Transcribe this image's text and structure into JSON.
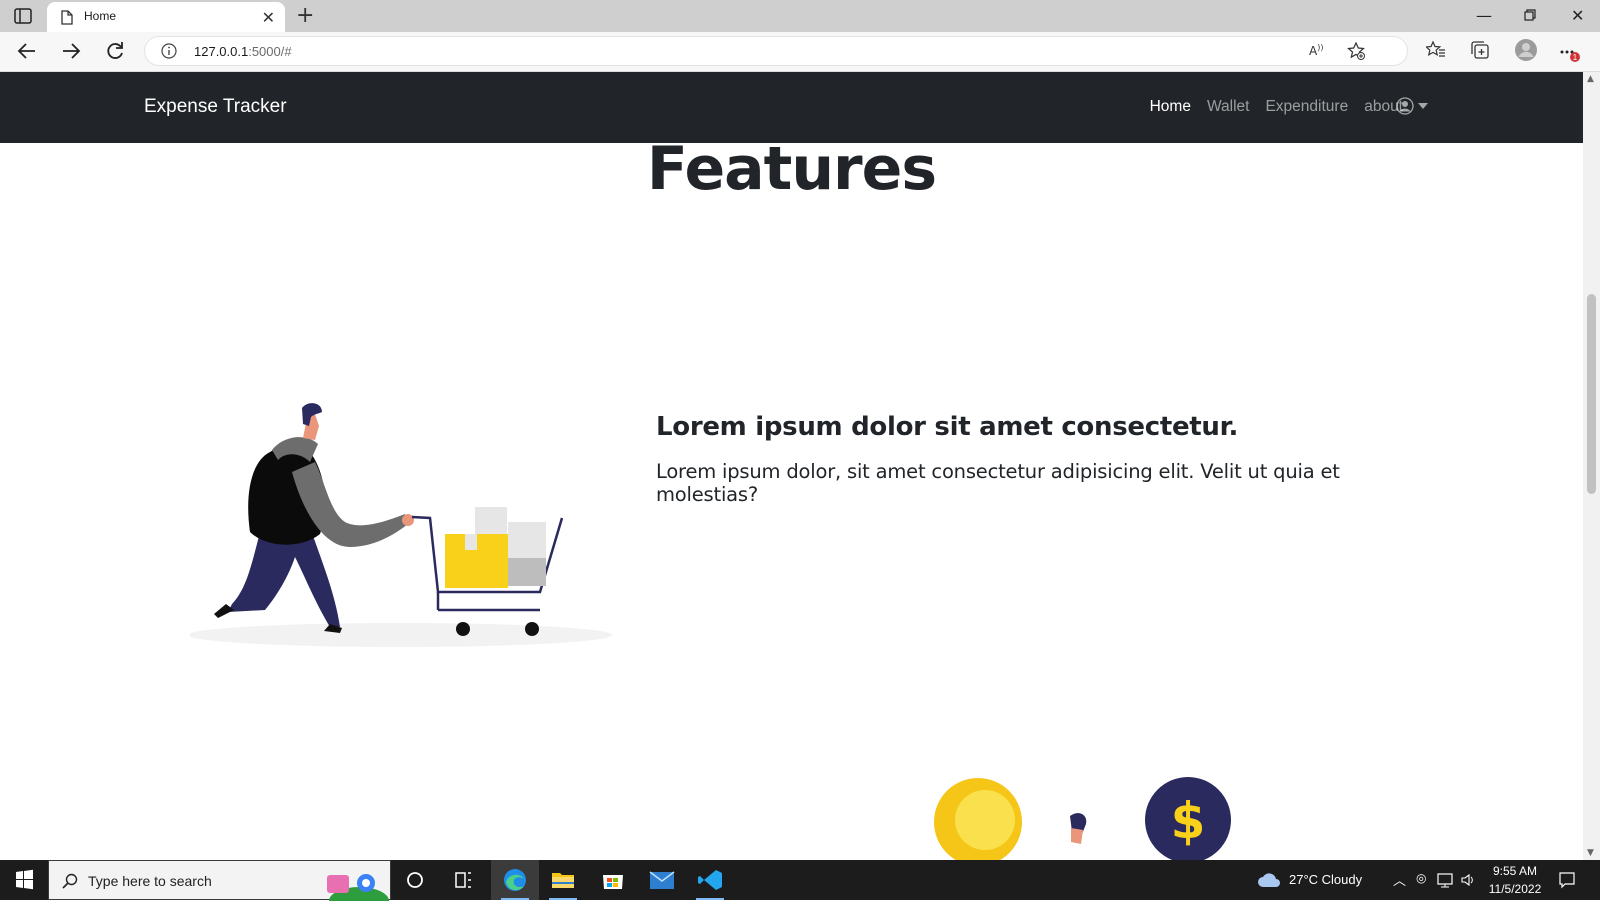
{
  "browser": {
    "tab_title": "Home",
    "url_host": "127.0.0.1",
    "url_rest": ":5000/#",
    "notification_badge": "1"
  },
  "app": {
    "brand": "Expense Tracker",
    "nav": [
      {
        "label": "Home",
        "active": true
      },
      {
        "label": "Wallet",
        "active": false
      },
      {
        "label": "Expenditure",
        "active": false
      },
      {
        "label": "about",
        "active": false
      }
    ]
  },
  "page": {
    "section_title": "Features",
    "feature_heading": "Lorem ipsum dolor sit amet consectetur.",
    "feature_body": "Lorem ipsum dolor, sit amet consectetur adipisicing elit. Velit ut quia et molestias?"
  },
  "taskbar": {
    "search_placeholder": "Type here to search",
    "weather": "27°C  Cloudy",
    "time": "9:55 AM",
    "date": "11/5/2022"
  },
  "colors": {
    "navbar_bg": "#212529",
    "accent_yellow": "#f9d11a",
    "illustration_navy": "#2a2a5e"
  }
}
